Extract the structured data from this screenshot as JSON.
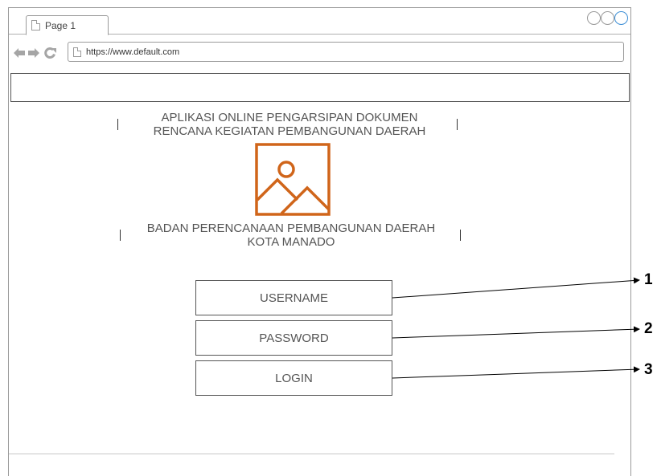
{
  "browser": {
    "tab_title": "Page 1",
    "url": "https://www.default.com",
    "window_controls": [
      "circle",
      "circle",
      "circle"
    ],
    "nav_icons": [
      "back-arrow-icon",
      "forward-arrow-icon",
      "refresh-icon"
    ]
  },
  "header": {
    "app_title_line1": "APLIKASI ONLINE PENGARSIPAN DOKUMEN",
    "app_title_line2": "RENCANA KEGIATAN PEMBANGUNAN DAERAH",
    "agency_line1": "BADAN PERENCANAAN PEMBANGUNAN DAERAH",
    "agency_line2": "KOTA MANADO",
    "logo_icon": "image-placeholder-icon",
    "logo_color": "#d0651a"
  },
  "login_form": {
    "username_label": "USERNAME",
    "password_label": "PASSWORD",
    "login_label": "LOGIN"
  },
  "callouts": {
    "one": "1",
    "two": "2",
    "three": "3"
  }
}
